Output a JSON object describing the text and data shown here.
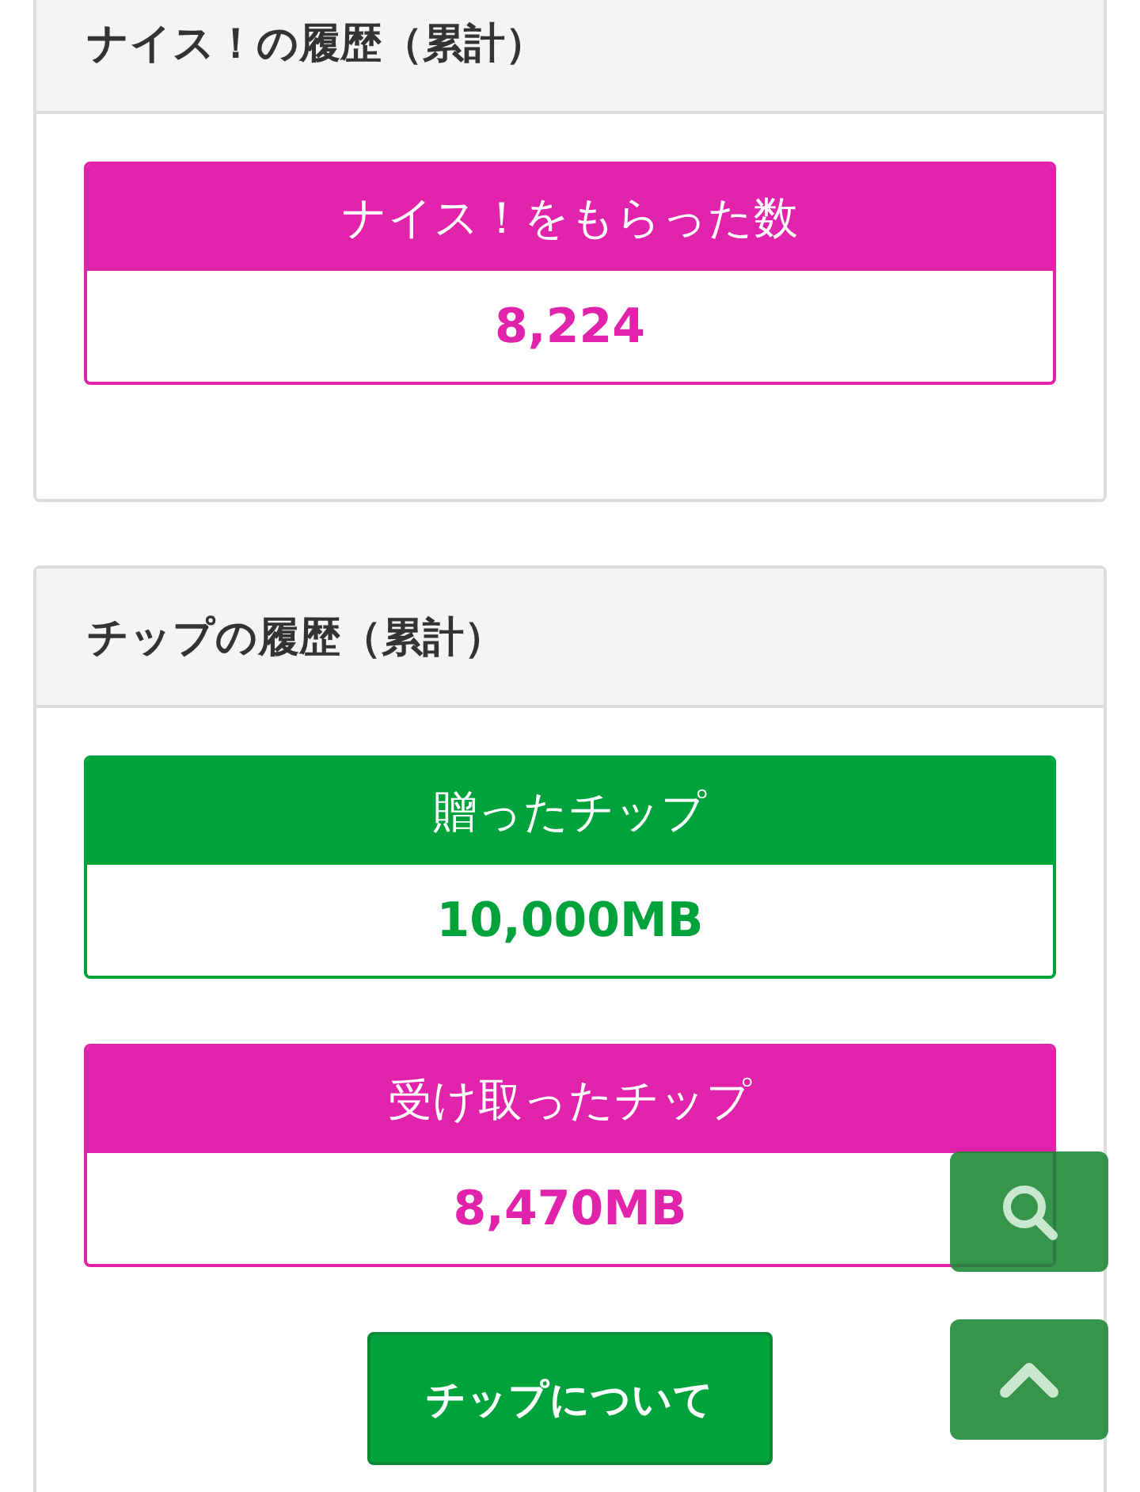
{
  "sections": [
    {
      "title": "ナイス！の履歴（累計）",
      "stats": [
        {
          "label": "ナイス！をもらった数",
          "value": "8,224",
          "color": "#e023aa"
        }
      ]
    },
    {
      "title": "チップの履歴（累計）",
      "stats": [
        {
          "label": "贈ったチップ",
          "value": "10,000MB",
          "color": "#00a23c"
        },
        {
          "label": "受け取ったチップ",
          "value": "8,470MB",
          "color": "#e023aa"
        }
      ],
      "button": "チップについて"
    }
  ]
}
